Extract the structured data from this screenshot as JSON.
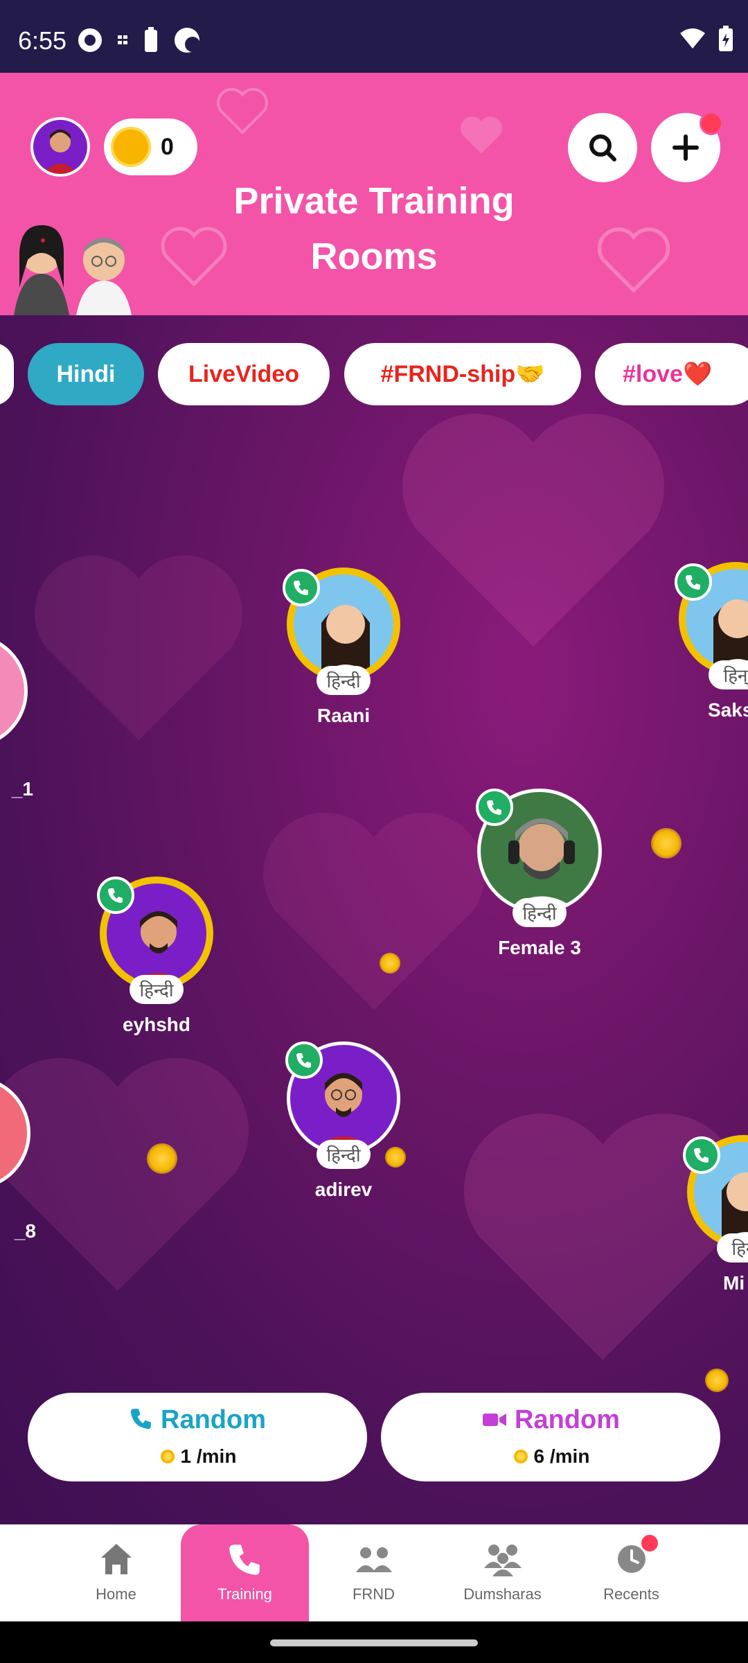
{
  "status_bar": {
    "time": "6:55"
  },
  "header": {
    "coins": "0",
    "title_line1": "Private Training",
    "title_line2": "Rooms"
  },
  "tags": [
    {
      "label": "Hindi",
      "active": true
    },
    {
      "label": "LiveVideo",
      "color": "#e8241c"
    },
    {
      "label": "#FRND-ship🤝",
      "color": "#e8241c"
    },
    {
      "label": "#love❤️",
      "color": "#e8339a"
    }
  ],
  "users": [
    {
      "name": "Raani",
      "lang": "हिन्दी"
    },
    {
      "name": "Saks",
      "lang": "हिन्"
    },
    {
      "name": "_1",
      "lang": ""
    },
    {
      "name": "Female 3",
      "lang": "हिन्दी"
    },
    {
      "name": "eyhshd",
      "lang": "हिन्दी"
    },
    {
      "name": "adirev",
      "lang": "हिन्दी"
    },
    {
      "name": "_8",
      "lang": ""
    },
    {
      "name": "Mi",
      "lang": "हिन्"
    }
  ],
  "random_buttons": {
    "audio": {
      "label": "Random",
      "rate": "1 /min",
      "color": "#1aa3c8"
    },
    "video": {
      "label": "Random",
      "rate": "6 /min",
      "color": "#c33fd6"
    }
  },
  "nav": {
    "home": "Home",
    "training": "Training",
    "frnd": "FRND",
    "dumsharas": "Dumsharas",
    "recents": "Recents"
  },
  "colors": {
    "brand_pink": "#f354a8",
    "call_green": "#1fae63",
    "super_gold": "#f2c200"
  }
}
